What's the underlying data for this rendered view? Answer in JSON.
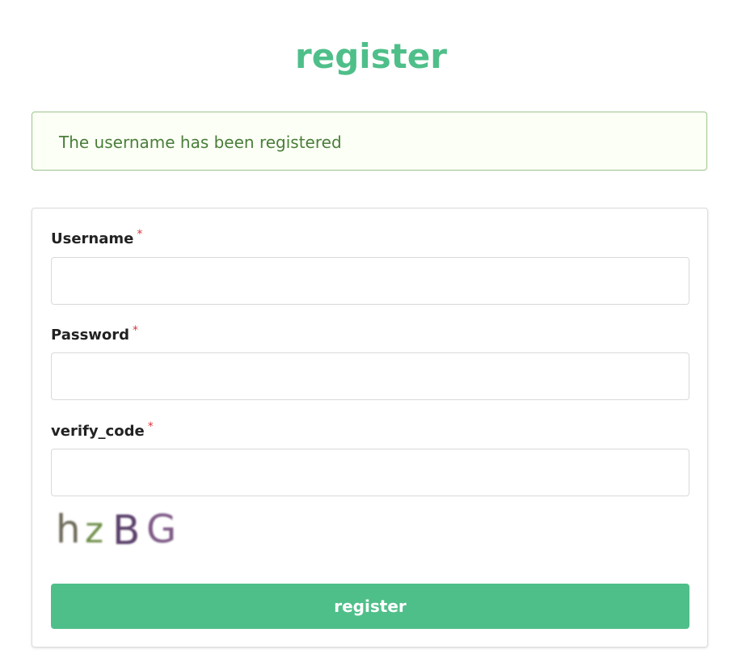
{
  "title": "register",
  "alert": {
    "message": "The username has been registered"
  },
  "form": {
    "fields": [
      {
        "label": "Username",
        "required_mark": "*",
        "value": "",
        "placeholder": ""
      },
      {
        "label": "Password",
        "required_mark": "*",
        "value": "",
        "placeholder": ""
      },
      {
        "label": "verify_code",
        "required_mark": "*",
        "value": "",
        "placeholder": ""
      }
    ],
    "captcha_text": "hzBG",
    "submit_label": "register"
  },
  "colors": {
    "brand_green": "#4fbf8a",
    "alert_text": "#4a7d3a",
    "alert_border": "#9cc48f",
    "alert_background": "#fbfff5",
    "required_red": "#d9363e"
  }
}
